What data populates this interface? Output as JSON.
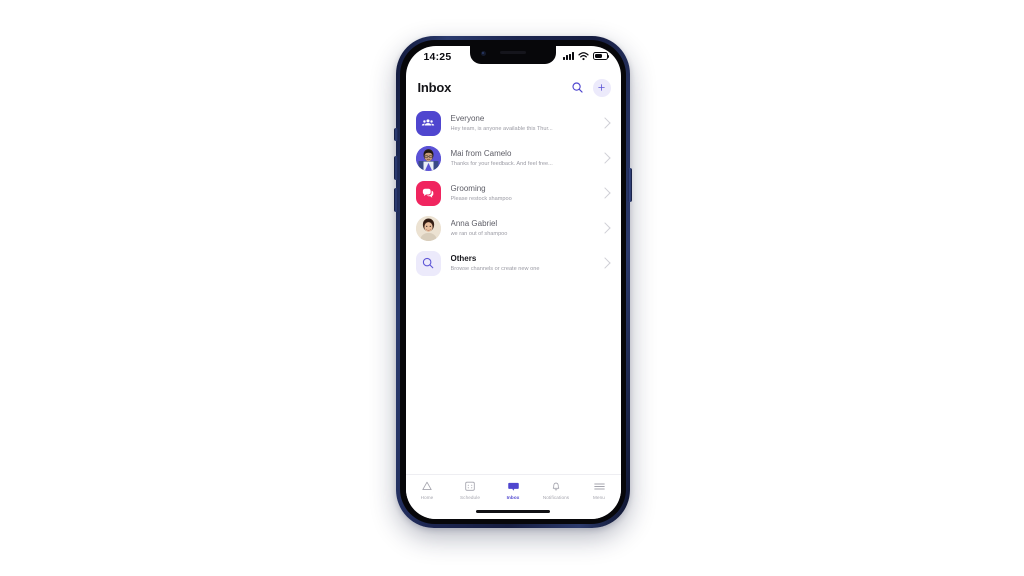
{
  "device": {
    "status_bar": {
      "time": "14:25",
      "cellular_icon": "signal-bars-icon",
      "wifi_icon": "wifi-icon",
      "battery_icon": "battery-icon",
      "battery_level_percent": 55
    },
    "frame_color": "#1c2550"
  },
  "header": {
    "title": "Inbox",
    "search_icon": "search-icon",
    "add_icon": "plus-icon"
  },
  "colors": {
    "accent": "#4f46cf",
    "accent_soft": "#eceafb",
    "pink": "#f0255f",
    "title_text": "#5d5d66",
    "subtitle_text": "#9b9ba4",
    "chevron": "#cfcfd6"
  },
  "conversations": [
    {
      "name": "Everyone",
      "preview": "Hey team, is anyone available this Thur...",
      "avatar_type": "tile",
      "avatar_icon": "people-group-icon",
      "avatar_color": "#4f46cf",
      "bold_title": false
    },
    {
      "name": "Mai from Camelo",
      "preview": "Thanks for your feedback. And feel free...",
      "avatar_type": "photo",
      "avatar_icon": "avatar-photo-mai",
      "avatar_color": "#4f46cf",
      "bold_title": false
    },
    {
      "name": "Grooming",
      "preview": "Please restock shampoo",
      "avatar_type": "tile",
      "avatar_icon": "chat-bubbles-icon",
      "avatar_color": "#f0255f",
      "bold_title": false
    },
    {
      "name": "Anna Gabriel",
      "preview": "we ran out of shampoo",
      "avatar_type": "photo",
      "avatar_icon": "avatar-photo-anna",
      "avatar_color": "#e8e0d4",
      "bold_title": false
    },
    {
      "name": "Others",
      "preview": "Browse channels or create new one",
      "avatar_type": "tile",
      "avatar_icon": "search-icon",
      "avatar_color": "#eceafb",
      "bold_title": true
    }
  ],
  "bottom_nav": {
    "items": [
      {
        "label": "Home",
        "icon": "home-triangle-icon",
        "active": false
      },
      {
        "label": "Schedule",
        "icon": "calendar-grid-icon",
        "active": false
      },
      {
        "label": "Inbox",
        "icon": "chat-bubble-icon",
        "active": true
      },
      {
        "label": "Notifications",
        "icon": "bell-icon",
        "active": false
      },
      {
        "label": "Menu",
        "icon": "hamburger-icon",
        "active": false
      }
    ]
  }
}
